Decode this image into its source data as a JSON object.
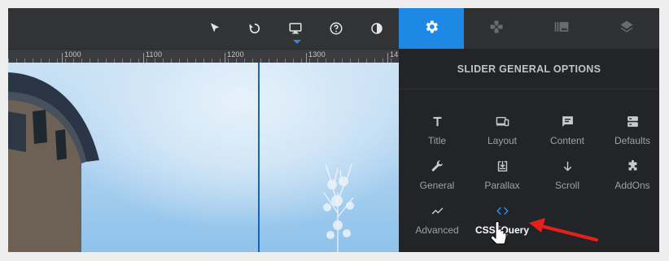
{
  "toolbar": {
    "icons": [
      "cursor-arrow-icon",
      "undo-icon",
      "desktop-monitor-icon",
      "help-circle-icon",
      "contrast-icon"
    ],
    "active_device": "desktop"
  },
  "ruler": {
    "labels": [
      "1000",
      "1100",
      "1200",
      "1300",
      "14"
    ]
  },
  "tabs": [
    {
      "icon": "gear-icon",
      "active": true
    },
    {
      "icon": "puzzle-icon",
      "active": false
    },
    {
      "icon": "media-library-icon",
      "active": false
    },
    {
      "icon": "layers-icon",
      "active": false
    }
  ],
  "panel": {
    "title": "SLIDER GENERAL OPTIONS",
    "options": [
      {
        "label": "Title",
        "icon": "title-icon"
      },
      {
        "label": "Layout",
        "icon": "devices-icon"
      },
      {
        "label": "Content",
        "icon": "comment-icon"
      },
      {
        "label": "Defaults",
        "icon": "storage-icon"
      },
      {
        "label": "General",
        "icon": "wrench-icon"
      },
      {
        "label": "Parallax",
        "icon": "import-box-icon"
      },
      {
        "label": "Scroll",
        "icon": "arrow-down-icon"
      },
      {
        "label": "AddOns",
        "icon": "puzzle-piece-icon"
      },
      {
        "label": "Advanced",
        "icon": "trending-icon"
      },
      {
        "label": "CSS/jQuery",
        "icon": "code-icon",
        "selected": true
      }
    ]
  },
  "colors": {
    "accent": "#1e88e5",
    "annotation_arrow": "#e5201b"
  }
}
